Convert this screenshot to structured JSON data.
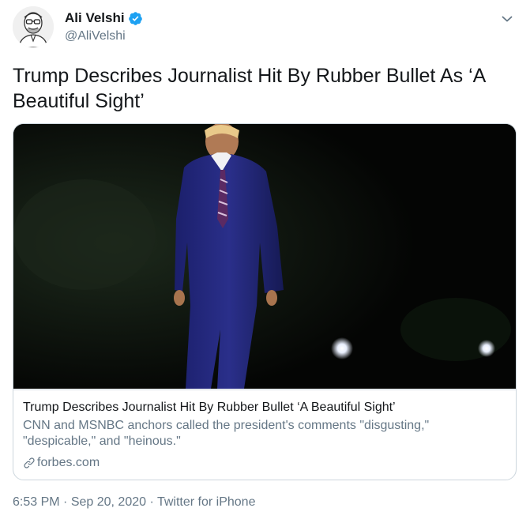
{
  "author": {
    "display_name": "Ali Velshi",
    "handle": "@AliVelshi",
    "verified_icon": "verified-badge-icon",
    "verified_color": "#1da1f2"
  },
  "menu": {
    "icon": "chevron-down-icon"
  },
  "tweet": {
    "text": "Trump Describes Journalist Hit By Rubber Bullet As ‘A Beautiful Sight’"
  },
  "card": {
    "image_alt": "photo of a man in a dark suit walking at night",
    "title": "Trump Describes Journalist Hit By Rubber Bullet ‘A Beautiful Sight’",
    "description": "CNN and MSNBC anchors called the president's comments \"disgusting,\" \"despicable,\" and \"heinous.\"",
    "domain": "forbes.com",
    "domain_icon": "link-icon"
  },
  "meta": {
    "time": "6:53 PM",
    "separator": "·",
    "date": "Sep 20, 2020",
    "source": "Twitter for iPhone"
  },
  "colors": {
    "text_primary": "#14171a",
    "text_secondary": "#657786",
    "border": "#ccd6dd",
    "accent": "#1da1f2"
  }
}
